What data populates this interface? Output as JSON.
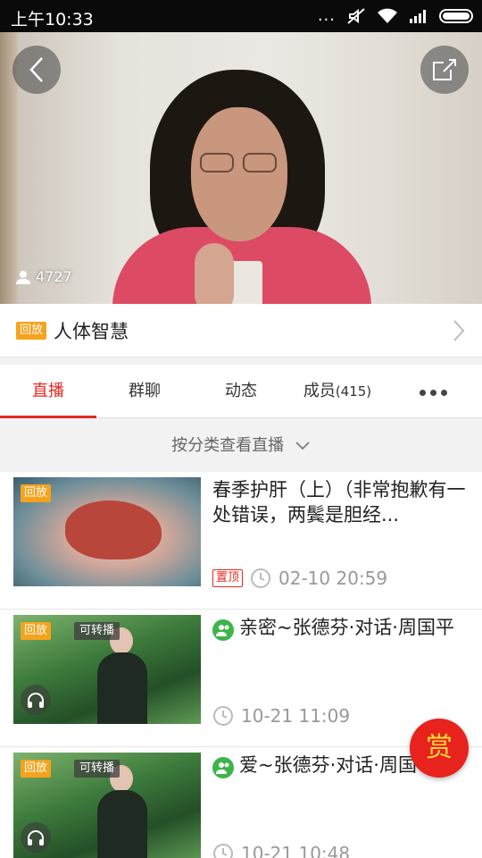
{
  "status_bar": {
    "time": "上午10:33",
    "dots": "..."
  },
  "video": {
    "viewer_count": "4727"
  },
  "live_title": {
    "badge": "回放",
    "title": "人体智慧"
  },
  "tabs": [
    {
      "label": "直播"
    },
    {
      "label": "群聊"
    },
    {
      "label": "动态"
    },
    {
      "label": "成员",
      "count": "(415)"
    }
  ],
  "filter": {
    "label": "按分类查看直播"
  },
  "items": [
    {
      "badge": "回放",
      "title": "春季护肝（上）（非常抱歉有一处错误，两鬓是胆经...",
      "pin": "置顶",
      "datetime": "02-10 20:59"
    },
    {
      "badge": "回放",
      "forward": "可转播",
      "title": "亲密~张德芬·对话·周国平",
      "datetime": "10-21 11:09"
    },
    {
      "badge": "回放",
      "forward": "可转播",
      "title": "爱~张德芬·对话·周国平",
      "datetime": "10-21 10:48"
    }
  ],
  "reward_button": {
    "label": "赏"
  },
  "colors": {
    "accent": "#e8281f",
    "badge": "#f5a31d",
    "group": "#3cb54a"
  }
}
